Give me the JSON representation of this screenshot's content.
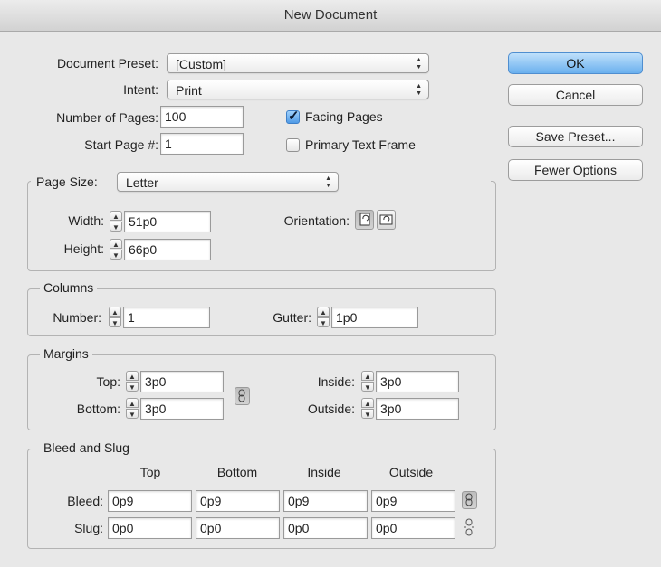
{
  "window": {
    "title": "New Document"
  },
  "preset": {
    "label": "Document Preset:",
    "value": "[Custom]"
  },
  "intent": {
    "label": "Intent:",
    "value": "Print"
  },
  "pages": {
    "label": "Number of Pages:",
    "value": "100"
  },
  "start_page": {
    "label": "Start Page #:",
    "value": "1"
  },
  "facing_pages": {
    "label": "Facing Pages",
    "checked": true
  },
  "primary_text_frame": {
    "label": "Primary Text Frame",
    "checked": false
  },
  "buttons": {
    "ok": "OK",
    "cancel": "Cancel",
    "save_preset": "Save Preset...",
    "fewer_options": "Fewer Options"
  },
  "page_size": {
    "label": "Page Size:",
    "value": "Letter",
    "width_label": "Width:",
    "width": "51p0",
    "height_label": "Height:",
    "height": "66p0",
    "orientation_label": "Orientation:",
    "orientation": "portrait"
  },
  "columns": {
    "legend": "Columns",
    "number_label": "Number:",
    "number": "1",
    "gutter_label": "Gutter:",
    "gutter": "1p0"
  },
  "margins": {
    "legend": "Margins",
    "top_label": "Top:",
    "top": "3p0",
    "bottom_label": "Bottom:",
    "bottom": "3p0",
    "inside_label": "Inside:",
    "inside": "3p0",
    "outside_label": "Outside:",
    "outside": "3p0"
  },
  "bleed_slug": {
    "legend": "Bleed and Slug",
    "headers": [
      "Top",
      "Bottom",
      "Inside",
      "Outside"
    ],
    "bleed_label": "Bleed:",
    "bleed": [
      "0p9",
      "0p9",
      "0p9",
      "0p9"
    ],
    "slug_label": "Slug:",
    "slug": [
      "0p0",
      "0p0",
      "0p0",
      "0p0"
    ]
  }
}
